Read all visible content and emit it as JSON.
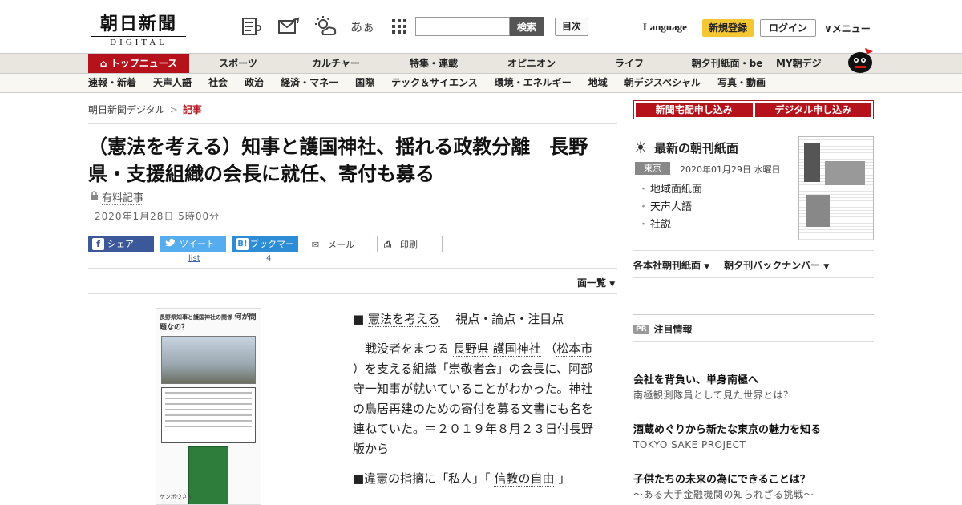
{
  "header": {
    "logo_main": "朝日新聞",
    "logo_sub": "DIGITAL",
    "search_button": "検索",
    "toc_button": "目次",
    "language": "Language",
    "signup": "新規登録",
    "login": "ログイン",
    "menu": "メニュー",
    "icons": [
      "news-icon",
      "mail-icon",
      "weather-icon",
      "font-size-icon",
      "grid-icon"
    ],
    "font_icon_text": "あぁ"
  },
  "nav_primary": [
    {
      "label": "トップニュース",
      "active": true
    },
    {
      "label": "スポーツ"
    },
    {
      "label": "カルチャー"
    },
    {
      "label": "特集・連載"
    },
    {
      "label": "オピニオン"
    },
    {
      "label": "ライフ"
    },
    {
      "label": "朝夕刊紙面・be"
    },
    {
      "label": "MY朝デジ"
    }
  ],
  "nav_secondary": [
    "速報・新着",
    "天声人語",
    "社会",
    "政治",
    "経済・マネー",
    "国際",
    "テック＆サイエンス",
    "環境・エネルギー",
    "地域",
    "朝デジスペシャル",
    "写真・動画"
  ],
  "breadcrumb": {
    "home": "朝日新聞デジタル",
    "current": "記事"
  },
  "article": {
    "title": "（憲法を考える）知事と護国神社、揺れる政教分離　長野県・支援組織の会長に就任、寄付も募る",
    "paid_label": "有料記事",
    "date": "2020年1月28日 5時00分",
    "share": {
      "facebook": "シェア",
      "twitter": "ツイート",
      "twitter_count": "list",
      "hatena": "ブックマーク",
      "hatena_count": "4",
      "mail": "メール",
      "print": "印刷"
    },
    "page_list": "面一覧",
    "figure_head": "長野県知事と護国神社の関係",
    "figure_question": "何が問題なの？",
    "figure_caption": "ケンポウさん",
    "series_label": "憲法を考える",
    "series_suffix": "視点・論点・注目点",
    "p1_a": "戦没者をまつる",
    "p1_link1": "長野県",
    "p1_link2": "護国神社",
    "p1_b": "（",
    "p1_link3": "松本市",
    "p1_c": "）を支える組織「崇敬者会」の会長に、阿部守一知事が就いていることがわかった。神社の鳥居再建のための寄付を募る文書にも名を連ねていた。＝２０１９年８月２３日付長野版から",
    "p2_a": "■違憲の指摘に「私人」「",
    "p2_link": "信教の自由",
    "p2_b": "」"
  },
  "sidebar": {
    "subscribe_paper": "新聞宅配申し込み",
    "subscribe_digital": "デジタル申し込み",
    "paper_title": "最新の朝刊紙面",
    "edition": "東京",
    "paper_date": "2020年01月29日 水曜日",
    "links": [
      "地域面紙面",
      "天声人語",
      "社説"
    ],
    "archive1": "各本社朝刊紙面",
    "archive2": "朝夕刊バックナンバー",
    "pr_badge": "PR",
    "pr_title": "注目情報",
    "ads": [
      {
        "title": "会社を背負い、単身南極へ",
        "sub": "南極観測隊員として見た世界とは？"
      },
      {
        "title": "酒蔵めぐりから新たな東京の魅力を知る",
        "sub": "TOKYO SAKE PROJECT"
      },
      {
        "title": "子供たちの未来の為にできることは？",
        "sub": "～ある大手金融機関の知られざる挑戦～"
      }
    ]
  }
}
